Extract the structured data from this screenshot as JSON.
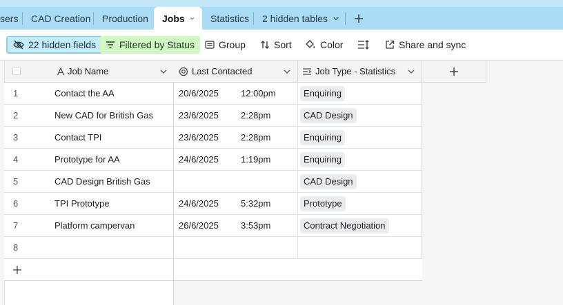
{
  "tabs": [
    {
      "label": "sers"
    },
    {
      "label": "CAD Creation"
    },
    {
      "label": "Production"
    },
    {
      "label": "Jobs"
    },
    {
      "label": "Statistics"
    },
    {
      "label": "2 hidden tables"
    }
  ],
  "toolbar": {
    "hidden_fields": "22 hidden fields",
    "filtered": "Filtered by Status",
    "group": "Group",
    "sort": "Sort",
    "color": "Color",
    "share": "Share and sync"
  },
  "columns": {
    "job_name": "Job Name",
    "last_contacted": "Last Contacted",
    "job_type": "Job Type - Statistics"
  },
  "rows": [
    {
      "num": "1",
      "name": "Contact the AA",
      "date": "20/6/2025",
      "time": "12:00pm",
      "type": "Enquiring"
    },
    {
      "num": "2",
      "name": "New CAD for British Gas",
      "date": "23/6/2025",
      "time": "2:28pm",
      "type": "CAD Design"
    },
    {
      "num": "3",
      "name": "Contact TPI",
      "date": "23/6/2025",
      "time": "2:28pm",
      "type": "Enquiring"
    },
    {
      "num": "4",
      "name": "Prototype for AA",
      "date": "24/6/2025",
      "time": "1:19pm",
      "type": "Enquiring"
    },
    {
      "num": "5",
      "name": "CAD Design British Gas",
      "date": "",
      "time": "",
      "type": "CAD Design"
    },
    {
      "num": "6",
      "name": "TPI Prototype",
      "date": "24/6/2025",
      "time": "5:32pm",
      "type": "Prototype"
    },
    {
      "num": "7",
      "name": "Platform campervan",
      "date": "26/6/2025",
      "time": "3:53pm",
      "type": "Contract Negotiation"
    },
    {
      "num": "8",
      "name": "",
      "date": "",
      "time": "",
      "type": ""
    }
  ]
}
